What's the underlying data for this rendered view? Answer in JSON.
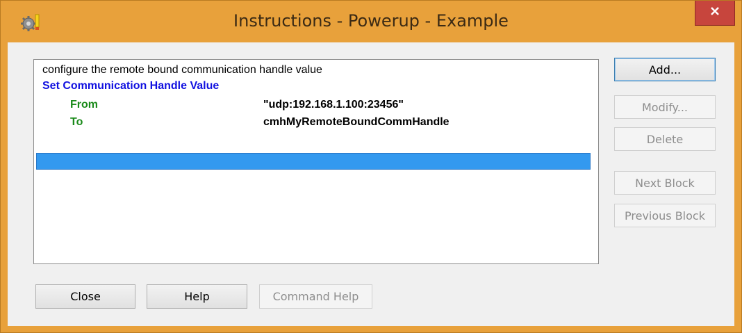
{
  "window": {
    "title": "Instructions - Powerup - Example",
    "close_label": "×"
  },
  "listing": {
    "comment": "configure the remote bound communication handle value",
    "command": "Set Communication Handle Value",
    "params": [
      {
        "label": "From",
        "value": "\"udp:192.168.1.100:23456\""
      },
      {
        "label": "To",
        "value": "cmhMyRemoteBoundCommHandle"
      }
    ],
    "selected_row": ""
  },
  "side_buttons": {
    "add": "Add...",
    "modify": "Modify...",
    "delete": "Delete",
    "next_block": "Next Block",
    "previous_block": "Previous Block"
  },
  "bottom_buttons": {
    "close": "Close",
    "help": "Help",
    "command_help": "Command Help"
  },
  "colors": {
    "frame": "#e8a13b",
    "close_button": "#c7453d",
    "selection": "#3399ef",
    "command_text": "#1010e0",
    "param_label_text": "#1a8a1a"
  },
  "icons": {
    "app": "gear-icon",
    "close": "close-icon"
  }
}
